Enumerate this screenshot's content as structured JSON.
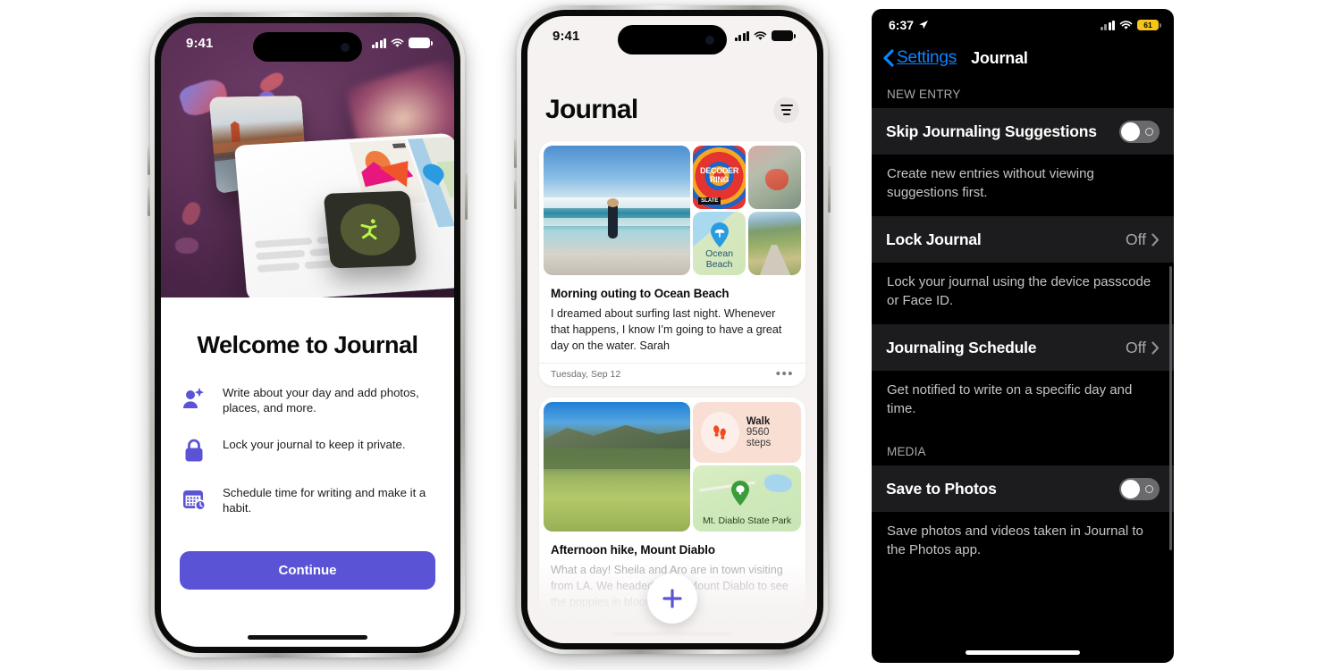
{
  "colors": {
    "accent_purple": "#5b53d6",
    "ios_blue": "#0a84ff",
    "battery_yellow": "#f5c518",
    "hero_bg": "#5b2f56",
    "settings_bg": "#000000",
    "settings_row_bg": "#1c1c1e"
  },
  "phone1": {
    "status": {
      "time": "9:41",
      "cellular_icon": "signal-bars-icon",
      "wifi_icon": "wifi-icon",
      "battery_icon": "battery-full-icon"
    },
    "hero_alt": "journal-collage-illustration",
    "title": "Welcome to Journal",
    "features": [
      {
        "icon": "person-sparkle-icon",
        "text": "Write about your day and add photos, places, and more."
      },
      {
        "icon": "lock-icon",
        "text": "Lock your journal to keep it private."
      },
      {
        "icon": "calendar-clock-icon",
        "text": "Schedule time for writing and make it a habit."
      }
    ],
    "continue_label": "Continue"
  },
  "phone2": {
    "status": {
      "time": "9:41",
      "cellular_icon": "signal-bars-icon",
      "wifi_icon": "wifi-icon",
      "battery_icon": "battery-full-icon"
    },
    "header_title": "Journal",
    "filter_icon": "filter-lines-icon",
    "entries": [
      {
        "title": "Morning outing to Ocean Beach",
        "body": "I dreamed about surfing last night. Whenever that happens, I know I’m going to have a great day on the water. Sarah",
        "date": "Tuesday, Sep 12",
        "more_icon": "ellipsis-icon",
        "media": {
          "main_alt": "surfer-on-beach-photo",
          "tile1_label": "DECODER RING",
          "tile1_sub": "SLATE",
          "tile2_alt": "seashell-on-rocks-photo",
          "map_label": "Ocean Beach",
          "map_pin_icon": "beach-umbrella-pin-icon",
          "tile4_alt": "coastal-road-photo"
        }
      },
      {
        "title": "Afternoon hike, Mount Diablo",
        "body": "What a day! Sheila and Aro are in town visiting from LA. We headed out to Mount Diablo to see the poppies in bloom. The",
        "media": {
          "main_alt": "green-hillside-meadow-photo",
          "workout_name": "Walk",
          "workout_value": "9560 steps",
          "workout_icon": "footsteps-icon",
          "map_label": "Mt. Diablo State Park",
          "map_pin_icon": "tree-park-pin-icon"
        }
      }
    ],
    "fab_icon": "plus-icon"
  },
  "phone3": {
    "status": {
      "time": "6:37",
      "location_icon": "location-arrow-icon",
      "cellular_icon": "signal-bars-icon",
      "wifi_icon": "wifi-icon",
      "battery_percent": "61"
    },
    "nav": {
      "back_icon": "chevron-left-icon",
      "back_label": "Settings",
      "title": "Journal"
    },
    "sections": [
      {
        "header": "NEW ENTRY",
        "rows": [
          {
            "label": "Skip Journaling Suggestions",
            "control": "toggle",
            "value": "off",
            "description": "Create new entries without viewing suggestions first."
          },
          {
            "label": "Lock Journal",
            "control": "disclosure",
            "value": "Off",
            "description": "Lock your journal using the device passcode or Face ID."
          },
          {
            "label": "Journaling Schedule",
            "control": "disclosure",
            "value": "Off",
            "description": "Get notified to write on a specific day and time."
          }
        ]
      },
      {
        "header": "MEDIA",
        "rows": [
          {
            "label": "Save to Photos",
            "control": "toggle",
            "value": "off",
            "description": "Save photos and videos taken in Journal to the Photos app."
          }
        ]
      }
    ]
  }
}
